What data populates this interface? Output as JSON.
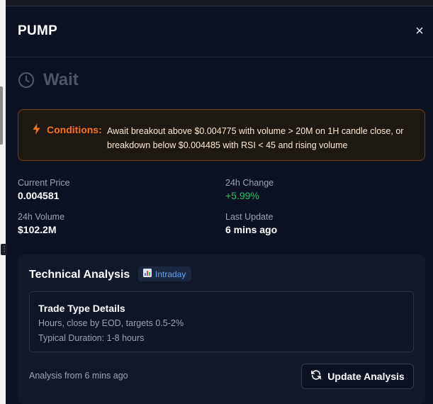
{
  "panel": {
    "title": "PUMP",
    "close_icon": "close-icon"
  },
  "status": {
    "icon": "clock-icon",
    "label": "Wait",
    "color": "#4b5563"
  },
  "conditions": {
    "icon": "bolt-icon",
    "label": "Conditions:",
    "text": "Await breakout above $0.004775 with volume > 20M on 1H candle close, or breakdown below $0.004485 with RSI < 45 and rising volume",
    "accent_color": "#f97316"
  },
  "stats": {
    "current_price": {
      "label": "Current Price",
      "value": "0.004581"
    },
    "change_24h": {
      "label": "24h Change",
      "value": "+5.99%",
      "color": "#22c55e"
    },
    "volume_24h": {
      "label": "24h Volume",
      "value": "$102.2M"
    },
    "last_update": {
      "label": "Last Update",
      "value": "6 mins ago"
    }
  },
  "technical_analysis": {
    "title": "Technical Analysis",
    "badge": {
      "icon": "bar-chart-icon",
      "label": "Intraday"
    },
    "trade_type": {
      "title": "Trade Type Details",
      "description": "Hours, close by EOD, targets 0.5-2%",
      "duration": "Typical Duration: 1-8 hours"
    },
    "footer_text": "Analysis from 6 mins ago",
    "update_button": {
      "icon": "refresh-icon",
      "label": "Update Analysis"
    }
  }
}
